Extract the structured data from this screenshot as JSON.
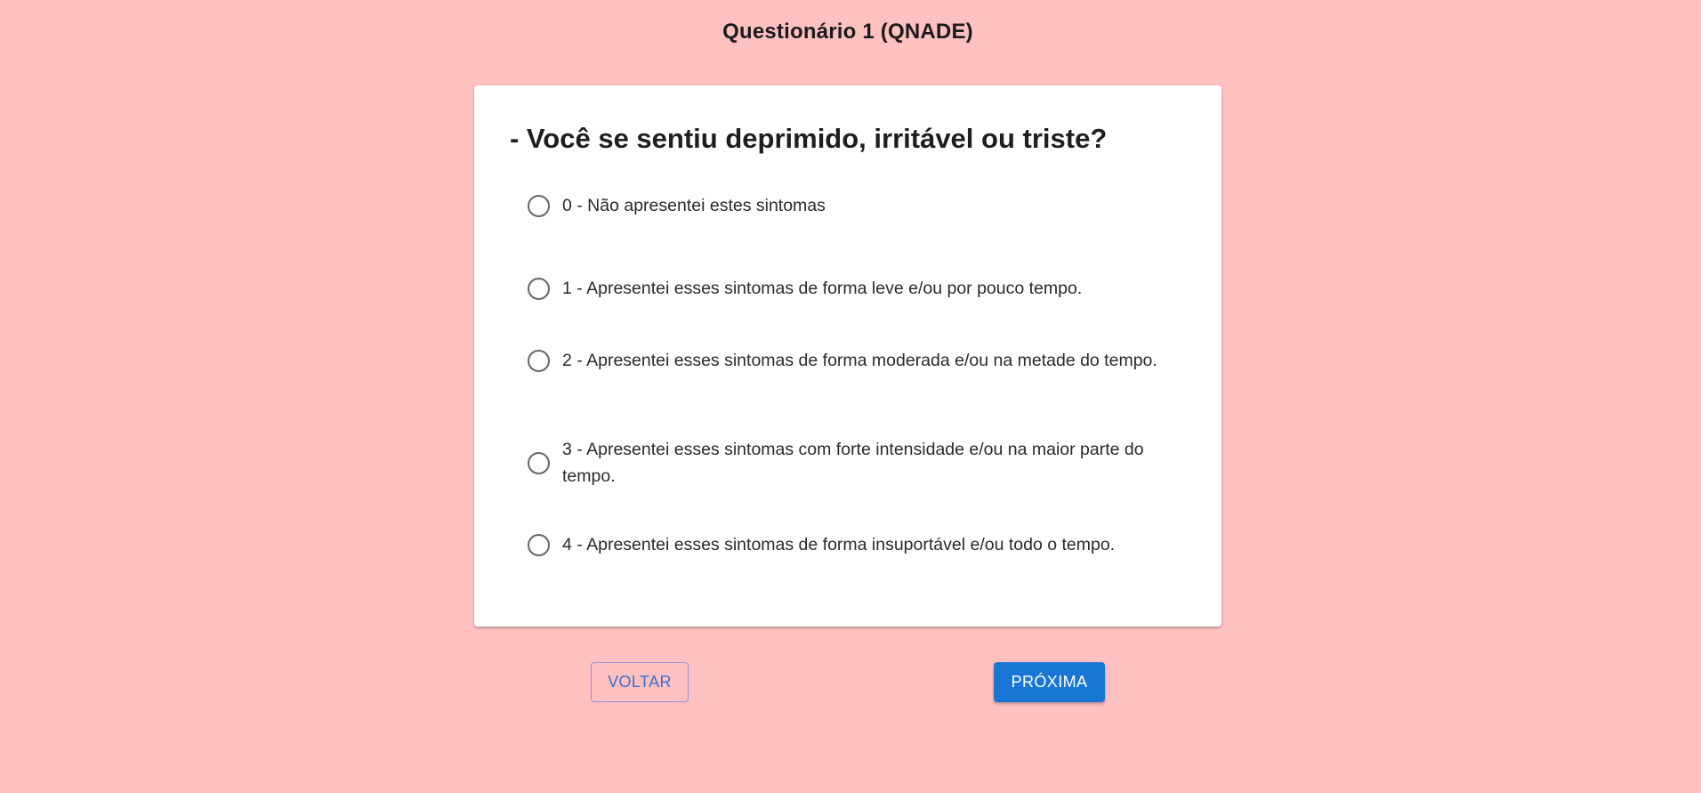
{
  "header": {
    "title": "Questionário 1 (QNADE)"
  },
  "question": {
    "text": "- Você se sentiu deprimido, irritável ou triste?",
    "options": [
      {
        "label": "0 - Não apresentei estes sintomas",
        "selected": false
      },
      {
        "label": "1 - Apresentei esses sintomas de forma leve e/ou por pouco tempo.",
        "selected": false
      },
      {
        "label": "2 - Apresentei esses sintomas de forma moderada e/ou na metade do tempo.",
        "selected": false
      },
      {
        "label": "3 - Apresentei esses sintomas com forte intensidade e/ou na maior parte do tempo.",
        "selected": false
      },
      {
        "label": "4 - Apresentei esses sintomas de forma insuportável e/ou todo o tempo.",
        "selected": false
      }
    ]
  },
  "navigation": {
    "back_label": "VOLTAR",
    "next_label": "PRÓXIMA"
  },
  "colors": {
    "background": "#ffc0c0",
    "primary": "#1976d2",
    "radio_border": "#666666"
  }
}
